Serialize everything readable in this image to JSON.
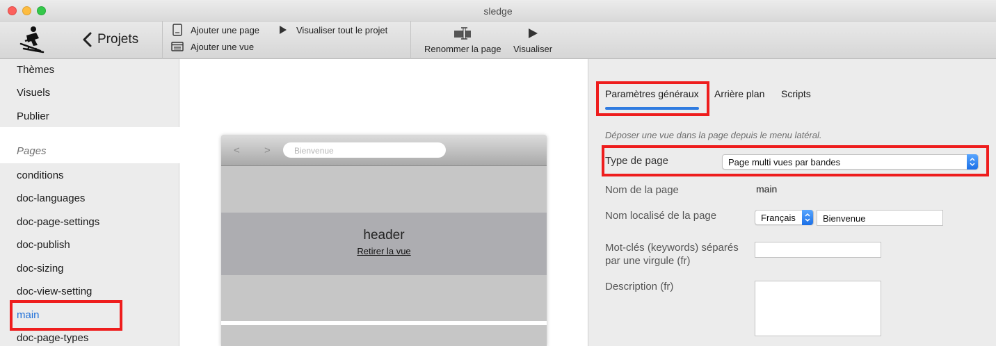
{
  "window": {
    "title": "sledge"
  },
  "toolbar": {
    "back_label": "Projets",
    "add_page": "Ajouter une page",
    "add_view": "Ajouter une vue",
    "preview_project": "Visualiser tout le projet",
    "rename_page": "Renommer la page",
    "preview": "Visualiser"
  },
  "sidebar": {
    "top_items": [
      {
        "label": "Thèmes"
      },
      {
        "label": "Visuels"
      },
      {
        "label": "Publier"
      }
    ],
    "section_title": "Pages",
    "pages": [
      {
        "label": "conditions"
      },
      {
        "label": "doc-languages"
      },
      {
        "label": "doc-page-settings"
      },
      {
        "label": "doc-publish"
      },
      {
        "label": "doc-sizing"
      },
      {
        "label": "doc-view-setting"
      },
      {
        "label": "main",
        "active": true
      },
      {
        "label": "doc-page-types"
      }
    ]
  },
  "preview": {
    "nav_back": "<",
    "nav_forward": ">",
    "url_placeholder": "Bienvenue",
    "header_title": "header",
    "remove_view": "Retirer la vue"
  },
  "inspector": {
    "tabs": [
      {
        "label": "Paramètres généraux",
        "active": true
      },
      {
        "label": "Arrière plan"
      },
      {
        "label": "Scripts"
      }
    ],
    "hint": "Déposer une vue dans la page depuis le menu latéral.",
    "page_type_label": "Type de page",
    "page_type_value": "Page multi vues par bandes",
    "page_name_label": "Nom de la page",
    "page_name_value": "main",
    "localized_name_label": "Nom localisé de la page",
    "language_value": "Français",
    "localized_name_value": "Bienvenue",
    "keywords_label_line1": "Mot-clés (keywords) séparés",
    "keywords_label_line2": "par une virgule (fr)",
    "keywords_value": "",
    "description_label": "Description (fr)",
    "description_value": ""
  },
  "colors": {
    "highlight_red": "#ee1d1d",
    "accent_blue": "#2f7be0",
    "active_link": "#1e6ed8"
  }
}
